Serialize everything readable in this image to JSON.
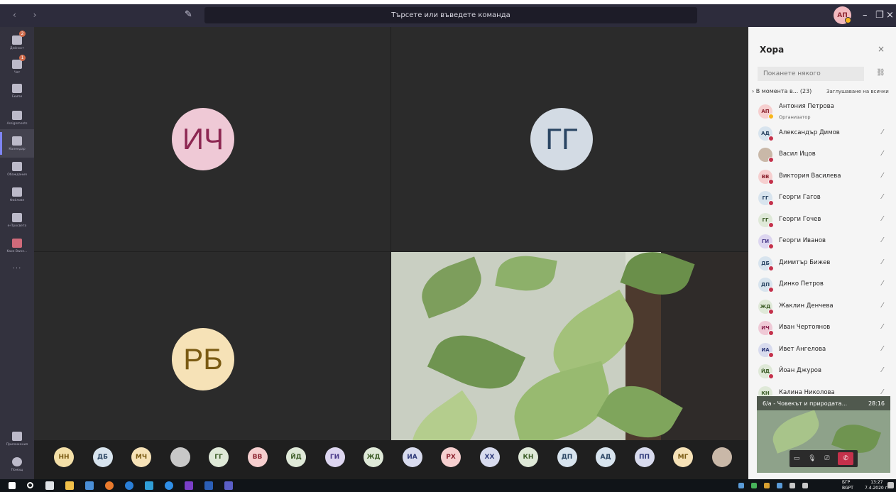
{
  "titlebar": {
    "nav": "‹ ›",
    "search_placeholder": "Търсете или въведете команда",
    "me_initials": "АП"
  },
  "rail": {
    "items": [
      {
        "label": "Дейност",
        "badge": "2",
        "icon": "bell-icon"
      },
      {
        "label": "Чат",
        "badge": "1",
        "icon": "chat-icon"
      },
      {
        "label": "Екипи",
        "icon": "teams-icon"
      },
      {
        "label": "Assignments",
        "icon": "assignments-icon"
      },
      {
        "label": "Календар",
        "icon": "calendar-icon",
        "active": true
      },
      {
        "label": "Обаждания",
        "icon": "phone-icon"
      },
      {
        "label": "Файлове",
        "icon": "files-icon"
      },
      {
        "label": "e-Просвета",
        "icon": "app-icon"
      },
      {
        "label": "Kaxe Bwxn...",
        "icon": "app-icon"
      }
    ],
    "more": "...",
    "apps_label": "Приложения",
    "help_label": "Помощ"
  },
  "stage": {
    "tiles": [
      {
        "initials": "ИЧ",
        "bg": "#efc9d6",
        "fg": "#8d2752"
      },
      {
        "initials": "ГГ",
        "bg": "#d3dbe4",
        "fg": "#2a4563"
      },
      {
        "initials": "РБ",
        "bg": "#f6e2b7",
        "fg": "#7a5a12"
      }
    ]
  },
  "roster": [
    {
      "initials": "НН",
      "bg": "#f4e0a8",
      "fg": "#7a5a12"
    },
    {
      "initials": "ДБ",
      "bg": "#d8e4ee",
      "fg": "#2a4563"
    },
    {
      "initials": "МЧ",
      "bg": "#f6e2b7",
      "fg": "#7a5a12"
    },
    {
      "initials": "",
      "bg": "#c8c8c8",
      "fg": "#333"
    },
    {
      "initials": "ГГ",
      "bg": "#dfe9d8",
      "fg": "#3f5f2a"
    },
    {
      "initials": "ВВ",
      "bg": "#f6cfcf",
      "fg": "#8d2430"
    },
    {
      "initials": "ЙД",
      "bg": "#dfe9d8",
      "fg": "#3f5f2a"
    },
    {
      "initials": "ГИ",
      "bg": "#ddd6f0",
      "fg": "#4b3b8a"
    },
    {
      "initials": "ЖД",
      "bg": "#dfe9d8",
      "fg": "#3f5f2a"
    },
    {
      "initials": "ИА",
      "bg": "#d8dbee",
      "fg": "#2f3a7a"
    },
    {
      "initials": "РХ",
      "bg": "#f6cfcf",
      "fg": "#8d2430"
    },
    {
      "initials": "ХХ",
      "bg": "#d8dbee",
      "fg": "#2f3a7a"
    },
    {
      "initials": "КН",
      "bg": "#dfe9d8",
      "fg": "#3f5f2a"
    },
    {
      "initials": "ДП",
      "bg": "#d8e4ee",
      "fg": "#2a4563"
    },
    {
      "initials": "АД",
      "bg": "#d8e4ee",
      "fg": "#2a4563"
    },
    {
      "initials": "ПП",
      "bg": "#d8dbee",
      "fg": "#2f3a7a"
    },
    {
      "initials": "МГ",
      "bg": "#f6e2b7",
      "fg": "#7a5a12"
    },
    {
      "initials": "",
      "bg": "#c9b8a8",
      "fg": "#333"
    }
  ],
  "people": {
    "title": "Хора",
    "invite_placeholder": "Поканете някого",
    "section": "› В момента в... (23)",
    "mute_all": "Заглушаване на всички",
    "list": [
      {
        "initials": "АП",
        "name": "Антония Петрова",
        "role": "Организатор",
        "bg": "#f6cfcf",
        "fg": "#8d2430",
        "organizer": true
      },
      {
        "initials": "АД",
        "name": "Александър Димов",
        "bg": "#d8e4ee",
        "fg": "#2a4563"
      },
      {
        "initials": "",
        "name": "Васил Ицов",
        "bg": "#c9b8a8",
        "fg": "#333"
      },
      {
        "initials": "ВВ",
        "name": "Виктория Василева",
        "bg": "#f6cfcf",
        "fg": "#8d2430"
      },
      {
        "initials": "ГГ",
        "name": "Георги Гагов",
        "bg": "#d8e4ee",
        "fg": "#2a4563"
      },
      {
        "initials": "ГГ",
        "name": "Георги Гочев",
        "bg": "#dfe9d8",
        "fg": "#3f5f2a"
      },
      {
        "initials": "ГИ",
        "name": "Георги Иванов",
        "bg": "#ddd6f0",
        "fg": "#4b3b8a"
      },
      {
        "initials": "ДБ",
        "name": "Димитър Бижев",
        "bg": "#d8e4ee",
        "fg": "#2a4563"
      },
      {
        "initials": "ДП",
        "name": "Динко Петров",
        "bg": "#d8e4ee",
        "fg": "#2a4563"
      },
      {
        "initials": "ЖД",
        "name": "Жаклин Денчева",
        "bg": "#dfe9d8",
        "fg": "#3f5f2a"
      },
      {
        "initials": "ИЧ",
        "name": "Иван Чертоянов",
        "bg": "#efc9d6",
        "fg": "#8d2752"
      },
      {
        "initials": "ИА",
        "name": "Ивет Ангелова",
        "bg": "#d8dbee",
        "fg": "#2f3a7a"
      },
      {
        "initials": "ЙД",
        "name": "Йоан Джуров",
        "bg": "#dfe9d8",
        "fg": "#3f5f2a"
      },
      {
        "initials": "КН",
        "name": "Калина Николова",
        "bg": "#dfe9d8",
        "fg": "#3f5f2a"
      }
    ]
  },
  "monitor": {
    "title": "6/а - Човекът и природата...",
    "time": "28:16"
  },
  "taskbar": {
    "lang": "БГР",
    "lang2": "BGPT",
    "time": "13:27",
    "date": "7.4.2020 г."
  }
}
